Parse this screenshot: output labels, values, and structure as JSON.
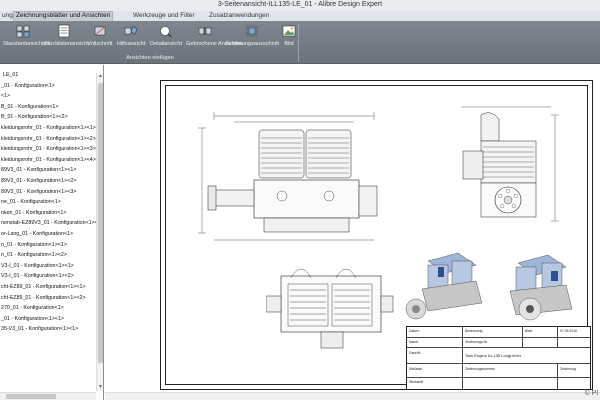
{
  "window": {
    "title": "3-Seitenansicht-ILL135-LE_01 - Alibre Design Expert"
  },
  "tabs": [
    {
      "label": "ung",
      "active": false
    },
    {
      "label": "Zeichnungsblätter und Ansichten",
      "active": true
    },
    {
      "label": "Werkzeuge und Filter",
      "active": false
    },
    {
      "label": "Zusatzanwendungen",
      "active": false
    }
  ],
  "ribbon": {
    "buttons": [
      {
        "label": "Standardansichten",
        "icon": "standard-views-icon"
      },
      {
        "label": "Stücklistenansicht",
        "icon": "bom-view-icon"
      },
      {
        "label": "Vollschnitt",
        "icon": "full-section-icon"
      },
      {
        "label": "Hilfsansicht",
        "icon": "auxiliary-view-icon"
      },
      {
        "label": "Detailansicht",
        "icon": "detail-view-icon"
      },
      {
        "label": "Gebrochene Ansichten",
        "icon": "broken-view-icon"
      },
      {
        "label": "Zeichnungsausschnitt",
        "icon": "drawing-crop-icon"
      },
      {
        "label": "Bild",
        "icon": "image-icon"
      }
    ],
    "group_label": "Ansichten einfügen",
    "accent": "#7e8690"
  },
  "tree": {
    "rows": [
      "LE_01",
      "_01 - Konfiguration<1>",
      "<1>",
      "B_01 - Konfiguration<1>",
      "B_01 - Konfiguration<1><2>",
      "kleidungsrohr_01 - Konfiguration<1><1>",
      "kleidungsrohr_01 - Konfiguration<1><2>",
      "kleidungsrohr_01 - Konfiguration<1><3>",
      "kleidungsrohr_01 - Konfiguration<1><4>",
      "89V3_01 - Konfiguration<1><1>",
      "89V3_01 - Konfiguration<1><2>",
      "89V3_01 - Konfiguration<1><3>",
      "ne_01 - Konfiguration<1>",
      "nken_01 - Konfiguration<1>",
      "nenstab-EZ89V3_01 - Konfiguration<1><1>",
      "or-Lang_01 - Konfiguration<1>",
      "n_01 - Konfiguration<1><1>",
      "n_01 - Konfiguration<1><2>",
      "V3-I_01 - Konfiguration<1><1>",
      "V3-I_01 - Konfiguration<1><2>",
      "cht-EZ89_01 - Konfiguration<1><1>",
      "cht-EZ89_01 - Konfiguration<1><2>",
      "270_01 - Konfiguration<1>",
      "_01 - Konfiguration<1><1>",
      "35-V3_01 - Konfiguration<1><1>"
    ]
  },
  "titleblock": {
    "labels": [
      "Benennung",
      "Zeichnungs-Nr.",
      "Blatt",
      "Datum",
      "Name",
      "Geprüft",
      "Maßstab",
      "Werkstoff"
    ],
    "part_name": "Twin Engine ILL135 LongLifeler",
    "sheet_size": "Zeichnung",
    "revision": "Zeichnungsnummer",
    "date": "07.06.2016"
  },
  "copyright": "© Pl"
}
